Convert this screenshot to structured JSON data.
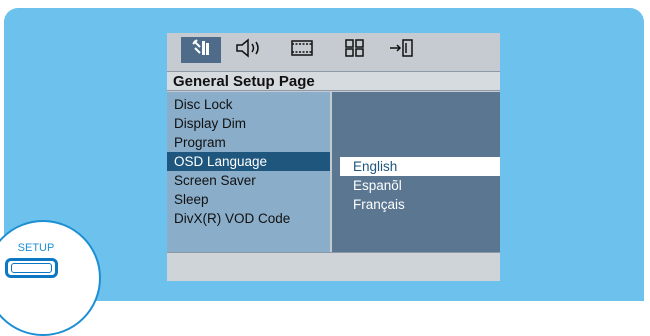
{
  "menu": {
    "title": "General Setup Page",
    "tabs": [
      {
        "icon": "general-setup-icon",
        "glyph": "🔧"
      },
      {
        "icon": "audio-setup-icon",
        "glyph": "🔈"
      },
      {
        "icon": "video-setup-icon",
        "glyph": "🎞"
      },
      {
        "icon": "preference-setup-icon",
        "glyph": "⊞"
      },
      {
        "icon": "exit-icon",
        "glyph": "→"
      }
    ],
    "items": [
      {
        "label": "Disc Lock"
      },
      {
        "label": "Display Dim"
      },
      {
        "label": "Program"
      },
      {
        "label": "OSD Language"
      },
      {
        "label": "Screen Saver"
      },
      {
        "label": "Sleep"
      },
      {
        "label": "DivX(R) VOD Code"
      }
    ],
    "options": [
      {
        "label": "English"
      },
      {
        "label": "Espanõl"
      },
      {
        "label": "Français"
      }
    ]
  },
  "remote": {
    "setup_label": "SETUP"
  },
  "colors": {
    "background": "#6cc2ec",
    "selected_item": "#1e567d",
    "active_tab": "#4e6c8a",
    "option_panel": "#5a7690",
    "accent": "#1c8fd3"
  }
}
